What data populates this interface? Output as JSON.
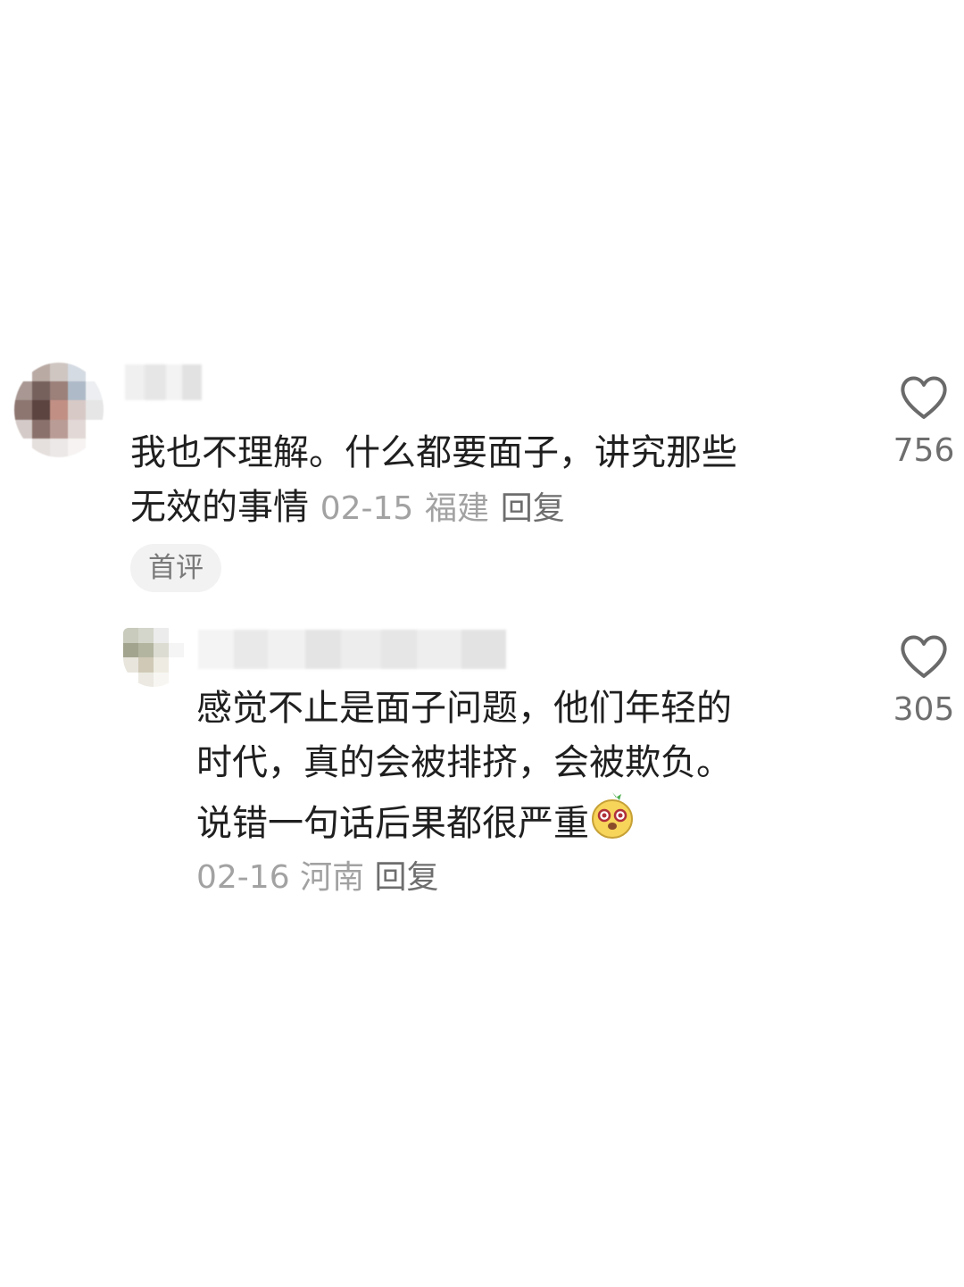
{
  "comments": [
    {
      "text_line1": "我也不理解。什么都要面子，讲究那些",
      "text_line2": "无效的事情",
      "date": "02-15",
      "location": "福建",
      "reply_label": "回复",
      "badge": "首评",
      "likes": "756"
    },
    {
      "text_line1": "感觉不止是面子问题，他们年轻的",
      "text_line2": "时代，真的会被排挤，会被欺负。",
      "text_line3": "说错一句话后果都很严重",
      "date": "02-16",
      "location": "河南",
      "reply_label": "回复",
      "likes": "305"
    }
  ],
  "icons": {
    "like": "heart-outline-icon",
    "emoji": "yellow-face-emoji"
  },
  "colors": {
    "text": "#1f1f1f",
    "meta": "#a2a2a2",
    "reply": "#6e6e6e",
    "badge_bg": "#f2f2f2"
  }
}
